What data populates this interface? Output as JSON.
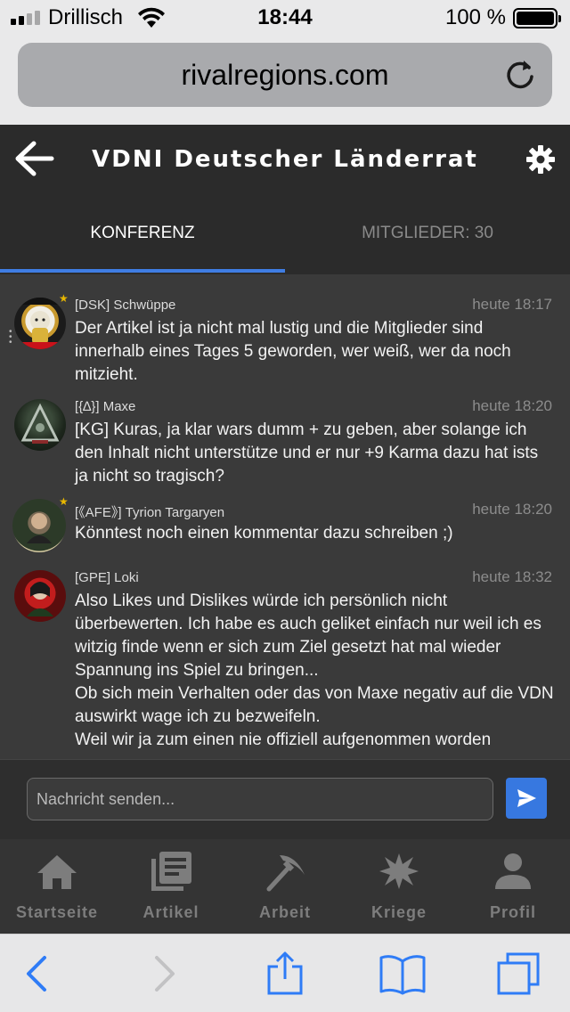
{
  "status_bar": {
    "carrier": "Drillisch",
    "time": "18:44",
    "battery": "100 %"
  },
  "browser": {
    "url": "rivalregions.com"
  },
  "header": {
    "title": "VDNI Deutscher Länderrat",
    "tabs": [
      {
        "label": "KONFERENZ",
        "active": true
      },
      {
        "label": "MITGLIEDER: 30",
        "active": false
      }
    ]
  },
  "messages": [
    {
      "author": "[DSK] Schwüppe",
      "time": "heute 18:17",
      "text": "Der Artikel ist ja nicht mal lustig und die Mitglieder sind innerhalb eines Tages 5 geworden, wer weiß, wer da noch mitzieht."
    },
    {
      "author": "[{∆}] Maxe",
      "time": "heute 18:20",
      "text": "[KG] Kuras, ja klar wars dumm + zu geben, aber solange ich den Inhalt nicht unterstütze und er nur +9 Karma dazu hat ists ja nicht so tragisch?"
    },
    {
      "author": "[《AFE》] Tyrion Targaryen",
      "time": "heute 18:20",
      "text": "Könntest noch einen kommentar dazu schreiben ;)"
    },
    {
      "author": "[GPE] Loki",
      "time": "heute 18:32",
      "text": "Also Likes und Dislikes würde ich persönlich nicht überbewerten. Ich habe es auch geliket einfach nur weil ich es witzig finde wenn er sich zum Ziel gesetzt hat mal wieder Spannung ins Spiel zu bringen...\nOb sich mein Verhalten oder das von Maxe negativ auf die VDN auswirkt wage ich zu bezweifeln.\nWeil wir ja zum einen nie offiziell aufgenommen worden"
    }
  ],
  "composer": {
    "placeholder": "Nachricht senden..."
  },
  "nav": [
    {
      "label": "Startseite",
      "icon": "home-icon"
    },
    {
      "label": "Artikel",
      "icon": "articles-icon"
    },
    {
      "label": "Arbeit",
      "icon": "pickaxe-icon"
    },
    {
      "label": "Kriege",
      "icon": "explosion-icon"
    },
    {
      "label": "Profil",
      "icon": "person-icon"
    }
  ],
  "colors": {
    "accent": "#3f7de3",
    "header_bg": "#2b2b2b",
    "chat_bg": "#3a3a3a",
    "ios_blue": "#2f7cf6"
  }
}
